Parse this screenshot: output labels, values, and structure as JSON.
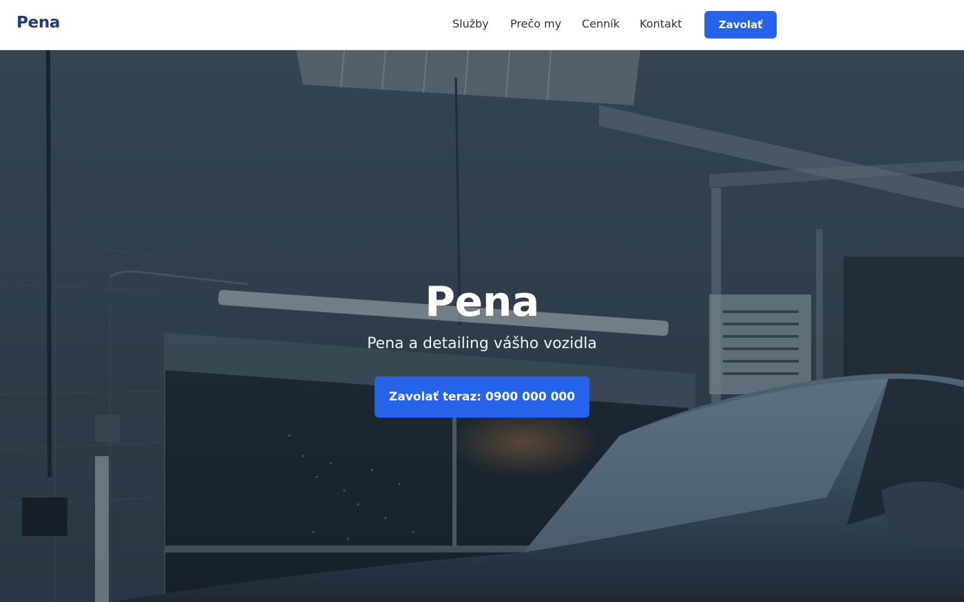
{
  "header": {
    "logo": "Pena",
    "nav": [
      {
        "label": "Služby"
      },
      {
        "label": "Prečo my"
      },
      {
        "label": "Cenník"
      },
      {
        "label": "Kontakt"
      }
    ],
    "cta_label": "Zavolať"
  },
  "hero": {
    "title": "Pena",
    "subtitle": "Pena a detailing vášho vozidla",
    "cta_label": "Zavolať teraz: 0900 000 000",
    "background_image": "foam-covered-car-in-car-wash-bay-photo"
  },
  "colors": {
    "brand": "#1e3a7b",
    "accent": "#2563eb",
    "header_bg": "#ffffff",
    "hero_text": "#ffffff"
  }
}
